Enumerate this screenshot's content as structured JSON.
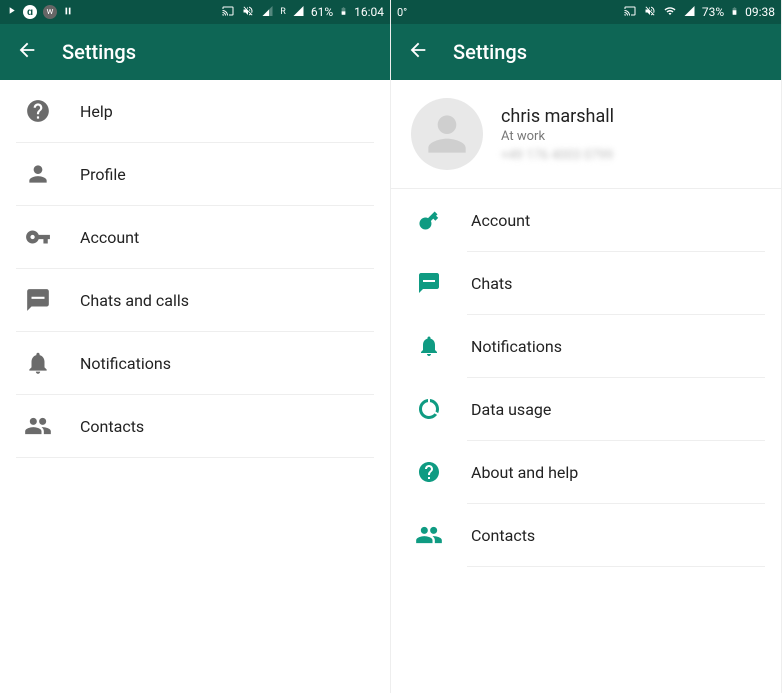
{
  "left": {
    "status": {
      "battery": "61%",
      "time": "16:04",
      "network_label": "R"
    },
    "title": "Settings",
    "items": [
      {
        "icon": "help",
        "label": "Help"
      },
      {
        "icon": "person",
        "label": "Profile"
      },
      {
        "icon": "key",
        "label": "Account"
      },
      {
        "icon": "chat",
        "label": "Chats and calls"
      },
      {
        "icon": "bell",
        "label": "Notifications"
      },
      {
        "icon": "contacts",
        "label": "Contacts"
      }
    ]
  },
  "right": {
    "status": {
      "temp": "0°",
      "battery": "73%",
      "time": "09:38"
    },
    "title": "Settings",
    "profile": {
      "name": "chris marshall",
      "status": "At work",
      "phone": "+49 176 4003 0799"
    },
    "items": [
      {
        "icon": "key",
        "label": "Account"
      },
      {
        "icon": "chat",
        "label": "Chats"
      },
      {
        "icon": "bell",
        "label": "Notifications"
      },
      {
        "icon": "datausage",
        "label": "Data usage"
      },
      {
        "icon": "help",
        "label": "About and help"
      },
      {
        "icon": "contacts",
        "label": "Contacts"
      }
    ]
  }
}
